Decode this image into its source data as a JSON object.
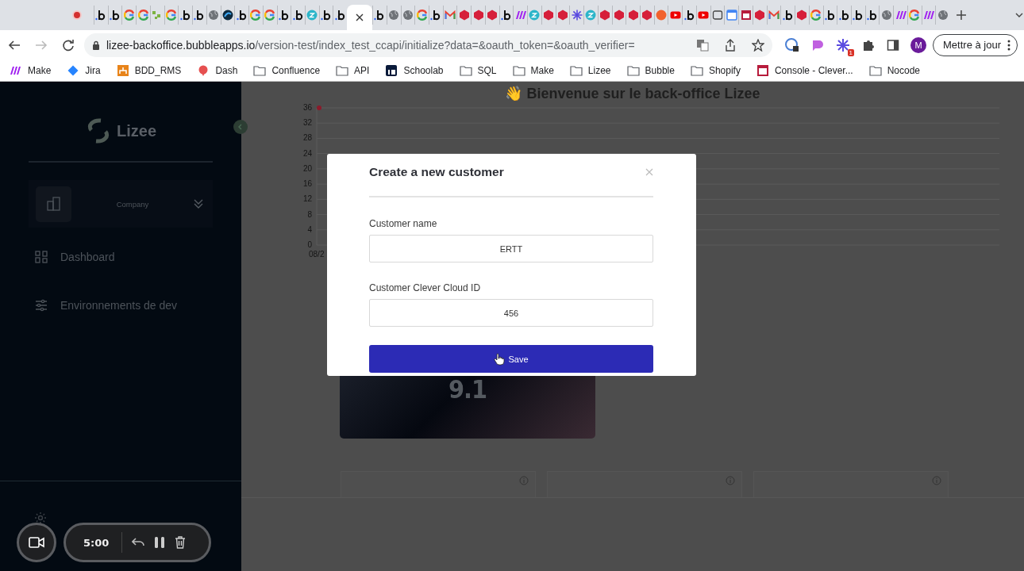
{
  "browser": {
    "tabs": [
      {
        "kind": "bubble",
        "selected": false
      },
      {
        "kind": "bubble",
        "selected": false
      },
      {
        "kind": "google",
        "selected": false
      },
      {
        "kind": "google",
        "selected": false
      },
      {
        "kind": "leaf",
        "selected": false
      },
      {
        "kind": "google",
        "selected": false
      },
      {
        "kind": "bubble",
        "selected": false
      },
      {
        "kind": "bubble",
        "selected": false
      },
      {
        "kind": "globe",
        "selected": false
      },
      {
        "kind": "dark",
        "selected": false
      },
      {
        "kind": "bubble",
        "selected": false
      },
      {
        "kind": "google",
        "selected": false
      },
      {
        "kind": "google",
        "selected": false
      },
      {
        "kind": "bubble",
        "selected": false
      },
      {
        "kind": "bubble",
        "selected": false
      },
      {
        "kind": "zcircle",
        "selected": false
      },
      {
        "kind": "bubble",
        "selected": false
      },
      {
        "kind": "bubble",
        "selected": false
      },
      {
        "selected": true
      },
      {
        "kind": "bubble",
        "selected": false
      },
      {
        "kind": "globe",
        "selected": false
      },
      {
        "kind": "globe",
        "selected": false
      },
      {
        "kind": "google",
        "selected": false
      },
      {
        "kind": "bubble",
        "selected": false
      },
      {
        "kind": "gmail",
        "selected": false
      },
      {
        "kind": "ruby",
        "selected": false
      },
      {
        "kind": "ruby",
        "selected": false
      },
      {
        "kind": "ruby",
        "selected": false
      },
      {
        "kind": "bubble",
        "selected": false
      },
      {
        "kind": "make",
        "selected": false
      },
      {
        "kind": "zcircle",
        "selected": false
      },
      {
        "kind": "ruby",
        "selected": false
      },
      {
        "kind": "ruby",
        "selected": false
      },
      {
        "kind": "sun",
        "selected": false
      },
      {
        "kind": "zcircle",
        "selected": false
      },
      {
        "kind": "ruby",
        "selected": false
      },
      {
        "kind": "ruby",
        "selected": false
      },
      {
        "kind": "ruby",
        "selected": false
      },
      {
        "kind": "ruby",
        "selected": false
      },
      {
        "kind": "orange",
        "selected": false
      },
      {
        "kind": "youtube",
        "selected": false
      },
      {
        "kind": "bubble",
        "selected": false
      },
      {
        "kind": "youtube",
        "selected": false
      },
      {
        "kind": "face",
        "selected": false
      },
      {
        "kind": "calendar",
        "selected": false
      },
      {
        "kind": "window",
        "selected": false
      },
      {
        "kind": "ruby",
        "selected": false
      },
      {
        "kind": "gmail",
        "selected": false
      },
      {
        "kind": "bubble",
        "selected": false
      },
      {
        "kind": "ruby",
        "selected": false
      },
      {
        "kind": "google",
        "selected": false
      },
      {
        "kind": "bubble",
        "selected": false
      },
      {
        "kind": "bubble",
        "selected": false
      },
      {
        "kind": "bubble",
        "selected": false
      },
      {
        "kind": "bubble",
        "selected": false
      },
      {
        "kind": "globe",
        "selected": false
      },
      {
        "kind": "make",
        "selected": false
      },
      {
        "kind": "google",
        "selected": false
      },
      {
        "kind": "make",
        "selected": false
      },
      {
        "kind": "globe",
        "selected": false
      }
    ],
    "url_host": "lizee-backoffice.bubbleapps.io",
    "url_path": "/version-test/index_test_ccapi/initialize?data=&oauth_token=&oauth_verifier=",
    "extension_badge": "1",
    "avatar_letter": "M",
    "update_button": "Mettre à jour",
    "bookmarks": [
      {
        "kind": "make",
        "label": "Make"
      },
      {
        "kind": "jira",
        "label": "Jira"
      },
      {
        "kind": "bdd",
        "label": "BDD_RMS"
      },
      {
        "kind": "dash",
        "label": "Dash"
      },
      {
        "kind": "folder",
        "label": "Confluence"
      },
      {
        "kind": "folder",
        "label": "API"
      },
      {
        "kind": "linkedin",
        "label": "Schoolab"
      },
      {
        "kind": "folder",
        "label": "SQL"
      },
      {
        "kind": "folder",
        "label": "Make"
      },
      {
        "kind": "folder",
        "label": "Lizee"
      },
      {
        "kind": "folder",
        "label": "Bubble"
      },
      {
        "kind": "folder",
        "label": "Shopify"
      },
      {
        "kind": "console",
        "label": "Console - Clever..."
      },
      {
        "kind": "folder",
        "label": "Nocode"
      }
    ]
  },
  "sidebar": {
    "logo_text": "Lizee",
    "company_label": "Company",
    "items": [
      {
        "kind": "grid",
        "label": "Dashboard"
      },
      {
        "kind": "sliders",
        "label": "Environnements de dev"
      }
    ]
  },
  "recorder": {
    "time": "5:00"
  },
  "main": {
    "title": "👋 Bienvenue sur le back-office Lizee",
    "chart_data": {
      "type": "line",
      "categories": [
        "08/2"
      ],
      "series": [
        {
          "color": "#8b1a2a",
          "marker": true,
          "values": [
            36
          ]
        }
      ],
      "grid": true,
      "ylim": [
        0,
        36
      ],
      "yticks": [
        0,
        4,
        8,
        12,
        16,
        20,
        24,
        28,
        32,
        36
      ]
    },
    "score_card": {
      "value": "9.1"
    },
    "stat_cards": [
      {
        "kind": "info"
      },
      {
        "kind": "info"
      },
      {
        "kind": "info"
      }
    ]
  },
  "modal": {
    "title": "Create a new customer",
    "fields": [
      {
        "label": "Customer name",
        "value": "ERTT"
      },
      {
        "label": "Customer Clever Cloud ID",
        "value": "456"
      }
    ],
    "save_button": "Save"
  }
}
